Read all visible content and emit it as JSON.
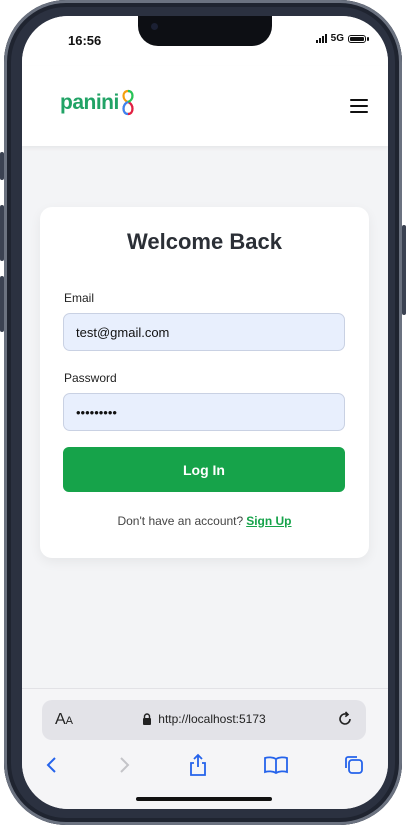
{
  "status": {
    "time": "16:56",
    "network": "5G"
  },
  "app": {
    "logo_text": "panini",
    "colors": {
      "brand": "#21a366",
      "button": "#16a34a",
      "input_bg": "#e8effd"
    }
  },
  "login": {
    "title": "Welcome Back",
    "email_label": "Email",
    "email_value": "test@gmail.com",
    "password_label": "Password",
    "password_value": "password1",
    "login_button": "Log In",
    "signup_prompt": "Don't have an account?",
    "signup_link": "Sign Up"
  },
  "browser": {
    "text_size_label_big": "A",
    "text_size_label_small": "A",
    "url": "http://localhost:5173",
    "icons": [
      "lock-icon",
      "reload-icon",
      "back-icon",
      "forward-icon",
      "share-icon",
      "bookmarks-icon",
      "tabs-icon"
    ]
  }
}
